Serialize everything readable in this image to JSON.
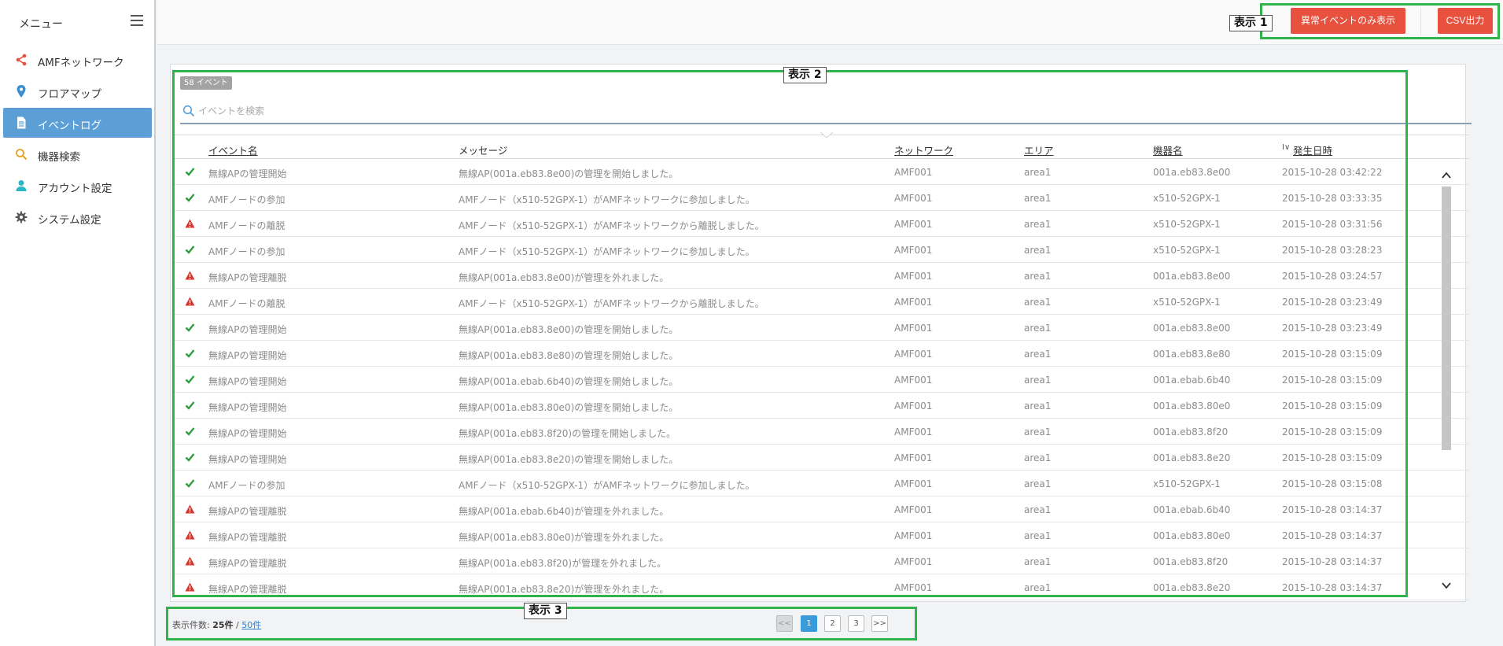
{
  "sidebar": {
    "title": "メニュー",
    "items": [
      {
        "label": "AMFネットワーク",
        "icon": "share-icon",
        "color": "#e8513e"
      },
      {
        "label": "フロアマップ",
        "icon": "map-pin-icon",
        "color": "#3b8fd0"
      },
      {
        "label": "イベントログ",
        "icon": "document-icon",
        "color": "#ffffff",
        "active": true
      },
      {
        "label": "機器検索",
        "icon": "search-icon",
        "color": "#e8a020"
      },
      {
        "label": "アカウント設定",
        "icon": "user-icon",
        "color": "#29b6c8"
      },
      {
        "label": "システム設定",
        "icon": "gear-icon",
        "color": "#555555"
      }
    ]
  },
  "toolbar": {
    "abnormal_only_label": "異常イベントのみ表示",
    "csv_label": "CSV出力"
  },
  "annotations": {
    "label1": "表示 1",
    "label2": "表示 2",
    "label3": "表示 3"
  },
  "events": {
    "count_badge": "58 イベント",
    "search_placeholder": "イベントを検索",
    "columns": [
      "イベント名",
      "メッセージ",
      "ネットワーク",
      "エリア",
      "機器名",
      "発生日時"
    ],
    "sort_indicator": "I∨",
    "rows": [
      {
        "status": "ok",
        "name": "無線APの管理開始",
        "message": "無線AP(001a.eb83.8e00)の管理を開始しました。",
        "network": "AMF001",
        "area": "area1",
        "device": "001a.eb83.8e00",
        "time": "2015-10-28 03:42:22"
      },
      {
        "status": "ok",
        "name": "AMFノードの参加",
        "message": "AMFノード（x510-52GPX-1）がAMFネットワークに参加しました。",
        "network": "AMF001",
        "area": "area1",
        "device": "x510-52GPX-1",
        "time": "2015-10-28 03:33:35"
      },
      {
        "status": "warn",
        "name": "AMFノードの離脱",
        "message": "AMFノード（x510-52GPX-1）がAMFネットワークから離脱しました。",
        "network": "AMF001",
        "area": "area1",
        "device": "x510-52GPX-1",
        "time": "2015-10-28 03:31:56"
      },
      {
        "status": "ok",
        "name": "AMFノードの参加",
        "message": "AMFノード（x510-52GPX-1）がAMFネットワークに参加しました。",
        "network": "AMF001",
        "area": "area1",
        "device": "x510-52GPX-1",
        "time": "2015-10-28 03:28:23"
      },
      {
        "status": "warn",
        "name": "無線APの管理離脱",
        "message": "無線AP(001a.eb83.8e00)が管理を外れました。",
        "network": "AMF001",
        "area": "area1",
        "device": "001a.eb83.8e00",
        "time": "2015-10-28 03:24:57"
      },
      {
        "status": "warn",
        "name": "AMFノードの離脱",
        "message": "AMFノード（x510-52GPX-1）がAMFネットワークから離脱しました。",
        "network": "AMF001",
        "area": "area1",
        "device": "x510-52GPX-1",
        "time": "2015-10-28 03:23:49"
      },
      {
        "status": "ok",
        "name": "無線APの管理開始",
        "message": "無線AP(001a.eb83.8e00)の管理を開始しました。",
        "network": "AMF001",
        "area": "area1",
        "device": "001a.eb83.8e00",
        "time": "2015-10-28 03:23:49"
      },
      {
        "status": "ok",
        "name": "無線APの管理開始",
        "message": "無線AP(001a.eb83.8e80)の管理を開始しました。",
        "network": "AMF001",
        "area": "area1",
        "device": "001a.eb83.8e80",
        "time": "2015-10-28 03:15:09"
      },
      {
        "status": "ok",
        "name": "無線APの管理開始",
        "message": "無線AP(001a.ebab.6b40)の管理を開始しました。",
        "network": "AMF001",
        "area": "area1",
        "device": "001a.ebab.6b40",
        "time": "2015-10-28 03:15:09"
      },
      {
        "status": "ok",
        "name": "無線APの管理開始",
        "message": "無線AP(001a.eb83.80e0)の管理を開始しました。",
        "network": "AMF001",
        "area": "area1",
        "device": "001a.eb83.80e0",
        "time": "2015-10-28 03:15:09"
      },
      {
        "status": "ok",
        "name": "無線APの管理開始",
        "message": "無線AP(001a.eb83.8f20)の管理を開始しました。",
        "network": "AMF001",
        "area": "area1",
        "device": "001a.eb83.8f20",
        "time": "2015-10-28 03:15:09"
      },
      {
        "status": "ok",
        "name": "無線APの管理開始",
        "message": "無線AP(001a.eb83.8e20)の管理を開始しました。",
        "network": "AMF001",
        "area": "area1",
        "device": "001a.eb83.8e20",
        "time": "2015-10-28 03:15:09"
      },
      {
        "status": "ok",
        "name": "AMFノードの参加",
        "message": "AMFノード（x510-52GPX-1）がAMFネットワークに参加しました。",
        "network": "AMF001",
        "area": "area1",
        "device": "x510-52GPX-1",
        "time": "2015-10-28 03:15:08"
      },
      {
        "status": "warn",
        "name": "無線APの管理離脱",
        "message": "無線AP(001a.ebab.6b40)が管理を外れました。",
        "network": "AMF001",
        "area": "area1",
        "device": "001a.ebab.6b40",
        "time": "2015-10-28 03:14:37"
      },
      {
        "status": "warn",
        "name": "無線APの管理離脱",
        "message": "無線AP(001a.eb83.80e0)が管理を外れました。",
        "network": "AMF001",
        "area": "area1",
        "device": "001a.eb83.80e0",
        "time": "2015-10-28 03:14:37"
      },
      {
        "status": "warn",
        "name": "無線APの管理離脱",
        "message": "無線AP(001a.eb83.8f20)が管理を外れました。",
        "network": "AMF001",
        "area": "area1",
        "device": "001a.eb83.8f20",
        "time": "2015-10-28 03:14:37"
      },
      {
        "status": "warn",
        "name": "無線APの管理離脱",
        "message": "無線AP(001a.eb83.8e20)が管理を外れました。",
        "network": "AMF001",
        "area": "area1",
        "device": "001a.eb83.8e20",
        "time": "2015-10-28 03:14:37"
      }
    ]
  },
  "footer": {
    "display_count_label": "表示件数:",
    "current": "25件",
    "separator": "/",
    "other_option": "50件",
    "pagination": [
      "<<",
      "1",
      "2",
      "3",
      ">>"
    ],
    "active_page": "1"
  },
  "colors": {
    "accent": "#5b9fd6",
    "danger": "#e8513e",
    "ok": "#2e9e3e",
    "warn": "#d9342b",
    "annotation": "#2fb34a"
  }
}
